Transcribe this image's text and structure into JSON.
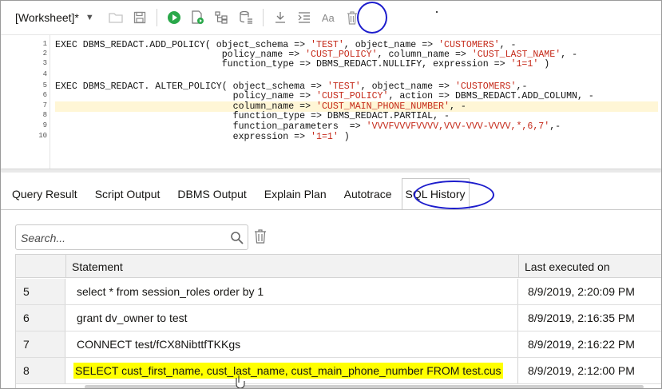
{
  "toolbar": {
    "worksheet_title": "[Worksheet]*",
    "dropdown_caret": "▼",
    "format_label": "Aa"
  },
  "editor": {
    "lines": [
      {
        "num": "1",
        "segments": [
          {
            "t": "EXEC DBMS_REDACT.ADD_POLICY( object_schema => ",
            "s": false
          },
          {
            "t": "'TEST'",
            "s": true
          },
          {
            "t": ", object_name => ",
            "s": false
          },
          {
            "t": "'CUSTOMERS'",
            "s": true
          },
          {
            "t": ", -",
            "s": false
          }
        ]
      },
      {
        "num": "2",
        "segments": [
          {
            "t": "                              policy_name => ",
            "s": false
          },
          {
            "t": "'CUST_POLICY'",
            "s": true
          },
          {
            "t": ", column_name => ",
            "s": false
          },
          {
            "t": "'CUST_LAST_NAME'",
            "s": true
          },
          {
            "t": ", -",
            "s": false
          }
        ]
      },
      {
        "num": "3",
        "segments": [
          {
            "t": "                              function_type => DBMS_REDACT.NULLIFY, expression => ",
            "s": false
          },
          {
            "t": "'1=1'",
            "s": true
          },
          {
            "t": " )",
            "s": false
          }
        ]
      },
      {
        "num": "4",
        "segments": [
          {
            "t": "",
            "s": false
          }
        ]
      },
      {
        "num": "5",
        "segments": [
          {
            "t": "EXEC DBMS_REDACT. ALTER_POLICY( object_schema => ",
            "s": false
          },
          {
            "t": "'TEST'",
            "s": true
          },
          {
            "t": ", object_name => ",
            "s": false
          },
          {
            "t": "'CUSTOMERS'",
            "s": true
          },
          {
            "t": ",-",
            "s": false
          }
        ]
      },
      {
        "num": "6",
        "segments": [
          {
            "t": "                                policy_name => ",
            "s": false
          },
          {
            "t": "'CUST_POLICY'",
            "s": true
          },
          {
            "t": ", action => DBMS_REDACT.ADD_COLUMN, -",
            "s": false
          }
        ]
      },
      {
        "num": "7",
        "segments": [
          {
            "t": "                                column_name => ",
            "s": false
          },
          {
            "t": "'CUST_MAIN_PHONE_NUMBER'",
            "s": true
          },
          {
            "t": ", -",
            "s": false
          }
        ]
      },
      {
        "num": "8",
        "segments": [
          {
            "t": "                                function_type => DBMS_REDACT.PARTIAL, -",
            "s": false
          }
        ]
      },
      {
        "num": "9",
        "segments": [
          {
            "t": "                                function_parameters  => ",
            "s": false
          },
          {
            "t": "'VVVFVVVFVVVV,VVV-VVV-VVVV,*,6,7'",
            "s": true
          },
          {
            "t": ",-",
            "s": false
          }
        ]
      },
      {
        "num": "10",
        "segments": [
          {
            "t": "                                expression => ",
            "s": false
          },
          {
            "t": "'1=1'",
            "s": true
          },
          {
            "t": " )",
            "s": false
          }
        ]
      }
    ]
  },
  "tabs": [
    {
      "label": "Query Result",
      "active": false
    },
    {
      "label": "Script Output",
      "active": false
    },
    {
      "label": "DBMS Output",
      "active": false
    },
    {
      "label": "Explain Plan",
      "active": false
    },
    {
      "label": "Autotrace",
      "active": false
    },
    {
      "label": "SQL History",
      "active": true
    }
  ],
  "search": {
    "placeholder": "Search..."
  },
  "table": {
    "headers": {
      "statement": "Statement",
      "last_executed": "Last executed on"
    },
    "rows": [
      {
        "num": "5",
        "statement": "select * from session_roles order by 1",
        "time": "8/9/2019, 2:20:09 PM",
        "highlight": false
      },
      {
        "num": "6",
        "statement": "grant dv_owner to test",
        "time": "8/9/2019, 2:16:35 PM",
        "highlight": false
      },
      {
        "num": "7",
        "statement": "CONNECT test/fCX8NibttfTKKgs",
        "time": "8/9/2019, 2:16:22 PM",
        "highlight": false
      },
      {
        "num": "8",
        "statement": "SELECT cust_first_name, cust_last_name, cust_main_phone_number FROM test.cus",
        "time": "8/9/2019, 2:12:00 PM",
        "highlight": true
      }
    ]
  },
  "colors": {
    "accent_green": "#2aa84a",
    "highlight_yellow": "#ffff00",
    "annotation_blue": "#1d1dcc",
    "string_red": "#c52a1a"
  }
}
